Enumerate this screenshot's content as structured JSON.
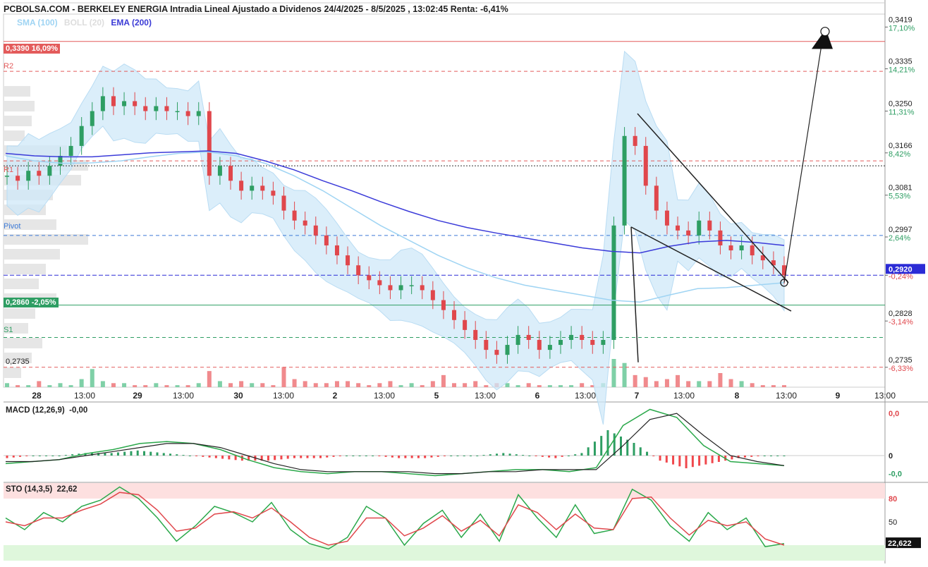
{
  "title": "PCBOLSA.COM - BERKELEY ENERGIA Intradia Lineal Ajustado a Dividenos 24/4/2025 - 8/5/2025 , 13:02:45 Renta: -6,41%",
  "legend": [
    {
      "label": "SMA (100)",
      "color": "#9fd4f3"
    },
    {
      "label": "BOLL (20)",
      "color": "#dddddd"
    },
    {
      "label": "EMA (200)",
      "color": "#3a3ad6"
    }
  ],
  "colors": {
    "up": "#2e9e63",
    "down": "#e0474c",
    "band": "#cfe8f8",
    "sma": "#9fd4f3",
    "ema": "#3b3bd9",
    "resistance": "#e35b5b",
    "pivot": "#3d7ad6",
    "support": "#2e9e63"
  },
  "levels": {
    "target": {
      "tag": "0,3390 16,09%",
      "value": 0.339
    },
    "r2": {
      "label": "R2",
      "value": 0.333
    },
    "r1": {
      "label": "R1",
      "value": 0.315
    },
    "black_dotted": {
      "value": 0.314
    },
    "pivot": {
      "label": "Pivot",
      "value": 0.3
    },
    "current": {
      "value": 0.292
    },
    "stop": {
      "tag": "0,2860 -2,05%",
      "value": 0.286
    },
    "s1": {
      "label": "S1",
      "value": 0.2795
    },
    "s2": {
      "label": "0,2735",
      "value": 0.2735
    }
  },
  "chart_data": [
    {
      "type": "line",
      "title": "PCBOLSA.COM - BERKELEY ENERGIA Intradia Lineal Ajustado a Dividenos 24/4/2025 - 8/5/2025 , 13:02:45 Renta: -6,41%",
      "x_ticks": [
        "28",
        "13:00",
        "29",
        "13:00",
        "30",
        "13:00",
        "2",
        "13:00",
        "5",
        "13:00",
        "6",
        "13:00",
        "7",
        "13:00",
        "8",
        "13:00",
        "9",
        "13:00"
      ],
      "y_ticks": [
        {
          "price": "0,3419",
          "pct": "17,10%",
          "pct_color": "#2e9e63"
        },
        {
          "price": "0,3335",
          "pct": "14,21%",
          "pct_color": "#2e9e63"
        },
        {
          "price": "0,3250",
          "pct": "11,31%",
          "pct_color": "#2e9e63"
        },
        {
          "price": "0,3166",
          "pct": "8,42%",
          "pct_color": "#2e9e63"
        },
        {
          "price": "0,3081",
          "pct": "5,53%",
          "pct_color": "#2e9e63"
        },
        {
          "price": "0,2997",
          "pct": "2,64%",
          "pct_color": "#2e9e63"
        },
        {
          "price": "0,2920",
          "pct": "-0,24%",
          "pct_color": "#e0474c"
        },
        {
          "price": "0,2828",
          "pct": "-3,14%",
          "pct_color": "#e0474c"
        },
        {
          "price": "0,2735",
          "pct": "-6,33%",
          "pct_color": "#e0474c"
        }
      ],
      "y_values": [
        0.3419,
        0.3335,
        0.325,
        0.3166,
        0.3081,
        0.2997,
        0.292,
        0.2828,
        0.2735
      ],
      "ylim": [
        0.2695,
        0.3445
      ],
      "last_price_label": "0,2920",
      "close_series": [
        0.312,
        0.311,
        0.313,
        0.312,
        0.314,
        0.316,
        0.318,
        0.322,
        0.325,
        0.328,
        0.326,
        0.327,
        0.326,
        0.325,
        0.326,
        0.325,
        0.325,
        0.324,
        0.325,
        0.312,
        0.314,
        0.311,
        0.309,
        0.31,
        0.309,
        0.308,
        0.305,
        0.303,
        0.302,
        0.3,
        0.298,
        0.296,
        0.294,
        0.292,
        0.291,
        0.29,
        0.289,
        0.29,
        0.29,
        0.289,
        0.287,
        0.285,
        0.283,
        0.281,
        0.279,
        0.277,
        0.276,
        0.278,
        0.28,
        0.279,
        0.277,
        0.278,
        0.279,
        0.28,
        0.279,
        0.278,
        0.279,
        0.302,
        0.32,
        0.318,
        0.31,
        0.305,
        0.302,
        0.301,
        0.3,
        0.303,
        0.301,
        0.298,
        0.297,
        0.298,
        0.296,
        0.295,
        0.294,
        0.292
      ],
      "volume_series": [
        2,
        1,
        1,
        3,
        1,
        2,
        1,
        4,
        9,
        3,
        2,
        2,
        1,
        1,
        2,
        1,
        1,
        1,
        2,
        8,
        3,
        2,
        3,
        2,
        2,
        1,
        10,
        4,
        3,
        2,
        2,
        3,
        3,
        2,
        1,
        2,
        3,
        1,
        2,
        1,
        3,
        6,
        2,
        2,
        3,
        1,
        2,
        2,
        1,
        2,
        1,
        1,
        1,
        1,
        2,
        1,
        2,
        14,
        12,
        6,
        5,
        3,
        4,
        6,
        3,
        3,
        3,
        7,
        4,
        3,
        2,
        1,
        1,
        1
      ],
      "sma_series": [
        0.316,
        0.315,
        0.3145,
        0.3146,
        0.315,
        0.3158,
        0.3165,
        0.3168,
        0.316,
        0.3145,
        0.312,
        0.309,
        0.3055,
        0.302,
        0.299,
        0.296,
        0.2935,
        0.2915,
        0.29,
        0.289,
        0.288,
        0.287,
        0.2866,
        0.288,
        0.2893,
        0.2895,
        0.29,
        0.2905
      ],
      "ema_series": [
        0.3165,
        0.316,
        0.3158,
        0.3158,
        0.3162,
        0.3166,
        0.3168,
        0.317,
        0.3165,
        0.315,
        0.3132,
        0.311,
        0.309,
        0.3068,
        0.3048,
        0.303,
        0.3016,
        0.3005,
        0.2995,
        0.2985,
        0.2975,
        0.2968,
        0.2965,
        0.2978,
        0.2987,
        0.299,
        0.2986,
        0.298
      ]
    },
    {
      "type": "line",
      "title": "MACD (12,26,9)",
      "value_label": "-0,00",
      "y_ticks": [
        "0,0",
        "0",
        "-0,0"
      ],
      "y_tick_colors": [
        "#e0474c",
        "#222222",
        "#2e9e63"
      ],
      "macd_series": [
        -0.4,
        -0.3,
        -0.2,
        0.1,
        0.3,
        0.6,
        0.7,
        0.6,
        0.3,
        -0.2,
        -0.6,
        -0.8,
        -0.9,
        -0.8,
        -0.8,
        -0.9,
        -1.0,
        -0.9,
        -0.8,
        -0.7,
        -0.7,
        -0.8,
        -0.6,
        1.5,
        2.3,
        1.9,
        0.5,
        -0.3,
        -0.4,
        -0.5
      ],
      "signal_series": [
        -0.3,
        -0.3,
        -0.2,
        0.0,
        0.2,
        0.4,
        0.6,
        0.6,
        0.4,
        0.0,
        -0.4,
        -0.7,
        -0.8,
        -0.8,
        -0.8,
        -0.8,
        -0.9,
        -0.9,
        -0.8,
        -0.8,
        -0.7,
        -0.7,
        -0.7,
        0.5,
        1.8,
        2.1,
        1.0,
        0.0,
        -0.3,
        -0.5
      ],
      "ylim": [
        -1.3,
        2.6
      ]
    },
    {
      "type": "line",
      "title": "STO (14,3,5)",
      "value_label": "22,62",
      "last_value_tag": "22,622",
      "y_ticks": [
        "80",
        "50"
      ],
      "k_series": [
        55,
        40,
        62,
        50,
        70,
        78,
        95,
        80,
        55,
        25,
        45,
        70,
        62,
        50,
        75,
        40,
        22,
        15,
        30,
        70,
        55,
        20,
        48,
        65,
        30,
        60,
        25,
        85,
        55,
        30,
        72,
        35,
        40,
        92,
        78,
        45,
        25,
        62,
        40,
        55,
        18,
        22
      ],
      "d_series": [
        50,
        45,
        55,
        55,
        65,
        73,
        88,
        85,
        65,
        38,
        42,
        60,
        63,
        55,
        68,
        50,
        30,
        20,
        25,
        55,
        55,
        32,
        42,
        58,
        38,
        52,
        32,
        72,
        62,
        40,
        60,
        42,
        40,
        80,
        82,
        55,
        33,
        52,
        45,
        50,
        28,
        20
      ],
      "ylim": [
        0,
        100
      ]
    }
  ]
}
